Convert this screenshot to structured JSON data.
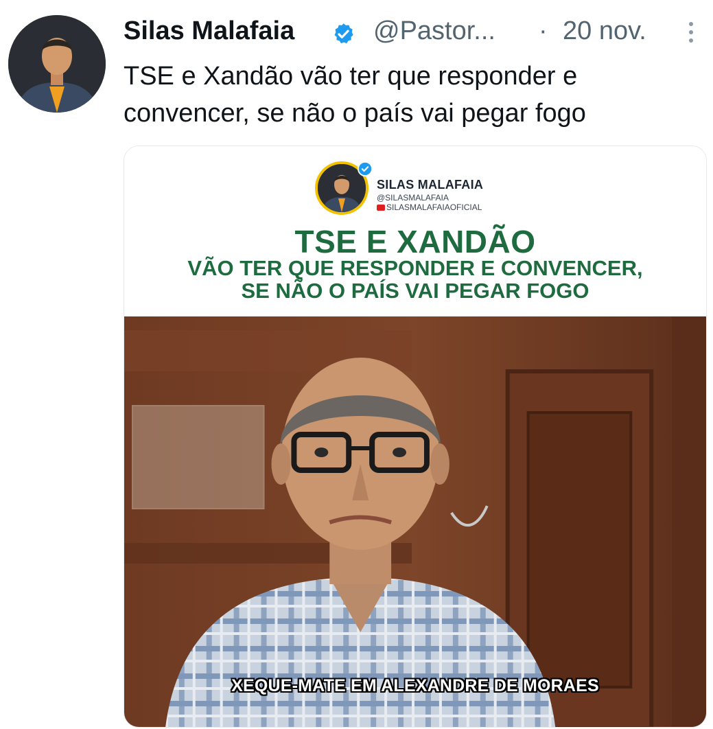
{
  "author": {
    "name": "Silas Malafaia",
    "handle": "@Pastor...",
    "separator": "·",
    "date": "20 nov."
  },
  "tweet": {
    "line1": "TSE e Xandão vão ter que responder e",
    "line2": "convencer, se não o país vai pegar fogo"
  },
  "media": {
    "channel_name": "SILAS MALAFAIA",
    "channel_handle": "@SILASMALAFAIA",
    "channel_youtube": "SILASMALAFAIAOFICIAL",
    "headline_main": "TSE E XANDÃO",
    "headline_line2": "VÃO TER QUE RESPONDER E CONVENCER,",
    "headline_line3": "SE NÃO O PAÍS VAI PEGAR FOGO",
    "caption": "XEQUE-MATE EM ALEXANDRE DE MORAES"
  },
  "icons": {
    "verified": "verified-badge-icon",
    "more": "more-options-icon",
    "youtube": "youtube-icon"
  },
  "colors": {
    "verified_blue": "#1d9bf0",
    "secondary_text": "#536471",
    "headline_green": "#1d6b3f",
    "youtube_red": "#e02020"
  }
}
